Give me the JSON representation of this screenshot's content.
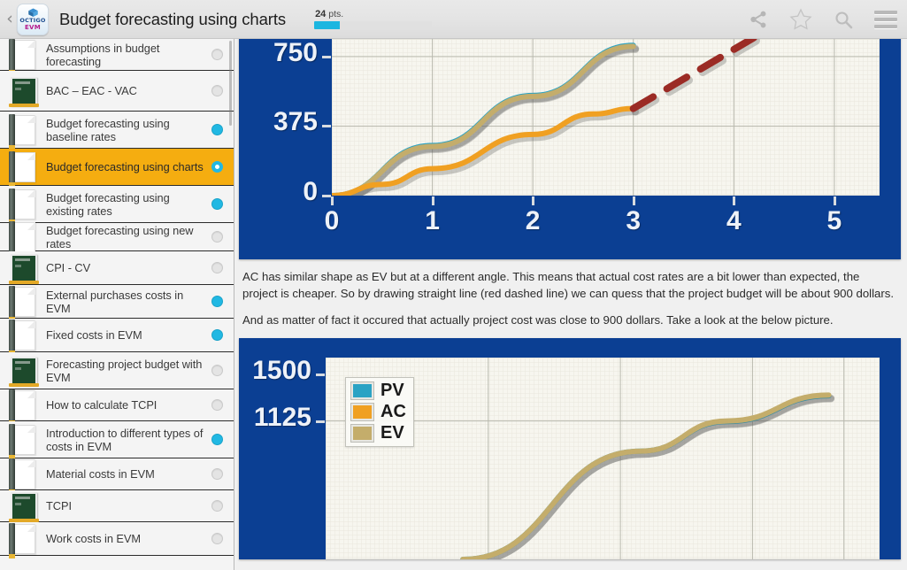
{
  "topbar": {
    "back_icon": "back-chevron-icon",
    "app_name_line1": "OCTIGO",
    "app_name_line2": "EVM",
    "title": "Budget forecasting using charts",
    "points_value": "24",
    "points_unit": "pts.",
    "points_percent": 22,
    "share_icon": "share-icon",
    "star_icon": "star-icon",
    "search_icon": "search-icon",
    "menu_icon": "hamburger-menu-icon",
    "accent_progress": "#1cb6e0"
  },
  "sidebar": {
    "items": [
      {
        "label": "Assumptions in budget forecasting",
        "icon": "article-icon",
        "status": "none",
        "selected": false
      },
      {
        "label": "BAC – EAC - VAC",
        "icon": "quiz-board-icon",
        "status": "none",
        "selected": false
      },
      {
        "label": "Budget forecasting using baseline rates",
        "icon": "article-icon",
        "status": "done",
        "selected": false
      },
      {
        "label": "Budget forecasting using charts",
        "icon": "article-icon",
        "status": "current",
        "selected": true
      },
      {
        "label": "Budget forecasting using existing rates",
        "icon": "article-icon",
        "status": "done",
        "selected": false
      },
      {
        "label": "Budget forecasting using new rates",
        "icon": "article-icon",
        "status": "none",
        "selected": false
      },
      {
        "label": "CPI - CV",
        "icon": "quiz-board-icon",
        "status": "none",
        "selected": false
      },
      {
        "label": "External purchases costs in EVM",
        "icon": "article-icon",
        "status": "done",
        "selected": false
      },
      {
        "label": "Fixed costs in EVM",
        "icon": "article-icon",
        "status": "done",
        "selected": false
      },
      {
        "label": "Forecasting project budget with EVM",
        "icon": "quiz-board-icon",
        "status": "none",
        "selected": false
      },
      {
        "label": "How to calculate TCPI",
        "icon": "article-icon",
        "status": "none",
        "selected": false
      },
      {
        "label": "Introduction to different types of costs in EVM",
        "icon": "article-icon",
        "status": "done",
        "selected": false
      },
      {
        "label": "Material costs in EVM",
        "icon": "article-icon",
        "status": "none",
        "selected": false
      },
      {
        "label": "TCPI",
        "icon": "quiz-board-icon",
        "status": "none",
        "selected": false
      },
      {
        "label": "Work costs in EVM",
        "icon": "article-icon",
        "status": "none",
        "selected": false
      }
    ],
    "selected_bg": "#f5ad10",
    "done_color": "#21b8e3"
  },
  "content": {
    "paragraph_1": "AC has similar shape as EV but at a different angle. This means that actual cost rates are a bit lower than expected, the project is cheaper. So by drawing straight line (red dashed line) we can quess that the project budget will be about 900 dollars.",
    "paragraph_2": "And as matter of fact it occured that actually project cost was close to 900 dollars. Take a look at the below picture."
  },
  "chart_data": [
    {
      "type": "line",
      "title": "",
      "xlabel": "",
      "ylabel": "",
      "x": [
        0,
        1,
        2,
        3,
        4,
        5
      ],
      "xticklabels": [
        "0",
        "1",
        "2",
        "3",
        "4",
        "5"
      ],
      "yticklabels": [
        "0",
        "375",
        "750"
      ],
      "yticks": [
        0,
        375,
        750
      ],
      "xlim": [
        0,
        5
      ],
      "ylim": [
        0,
        830
      ],
      "grid": true,
      "plot_bg": "#f7f6ef",
      "frame_bg": "#0b3f93",
      "legend": null,
      "series": [
        {
          "name": "PV",
          "color": "#2ba3c4",
          "style": "solid",
          "x": [
            0,
            1,
            2,
            3
          ],
          "values": [
            0,
            270,
            540,
            810
          ]
        },
        {
          "name": "EV",
          "color": "#c4ad6b",
          "style": "solid",
          "x": [
            0,
            1,
            2,
            3
          ],
          "values": [
            0,
            265,
            535,
            805
          ]
        },
        {
          "name": "AC",
          "color": "#f0a022",
          "style": "solid",
          "x": [
            0,
            0.5,
            1,
            2,
            2.6,
            3
          ],
          "values": [
            0,
            60,
            145,
            330,
            440,
            470
          ]
        },
        {
          "name": "forecast",
          "color": "#9b2b25",
          "style": "dashed",
          "x": [
            3,
            4.35
          ],
          "values": [
            470,
            900
          ]
        }
      ]
    },
    {
      "type": "line",
      "title": "",
      "xlabel": "",
      "ylabel": "",
      "yticklabels": [
        "1500",
        "1125"
      ],
      "yticks": [
        1125,
        1500
      ],
      "ylim": [
        0,
        1640
      ],
      "grid": true,
      "plot_bg": "#f7f6ef",
      "frame_bg": "#0b3f93",
      "legend": {
        "position": "upper-left-inside",
        "entries": [
          {
            "label": "PV",
            "color": "#2ba3c4"
          },
          {
            "label": "AC",
            "color": "#f0a022"
          },
          {
            "label": "EV",
            "color": "#c4ad6b"
          }
        ]
      },
      "series": [
        {
          "name": "PV",
          "color": "#2ba3c4",
          "style": "solid",
          "x": [
            1.35,
            3.1,
            3.95,
            4.95
          ],
          "values": [
            0,
            880,
            1120,
            1330
          ]
        },
        {
          "name": "EV",
          "color": "#c4ad6b",
          "style": "solid",
          "x": [
            1.35,
            3.1,
            3.95,
            4.95
          ],
          "values": [
            0,
            880,
            1125,
            1335
          ]
        }
      ]
    }
  ]
}
